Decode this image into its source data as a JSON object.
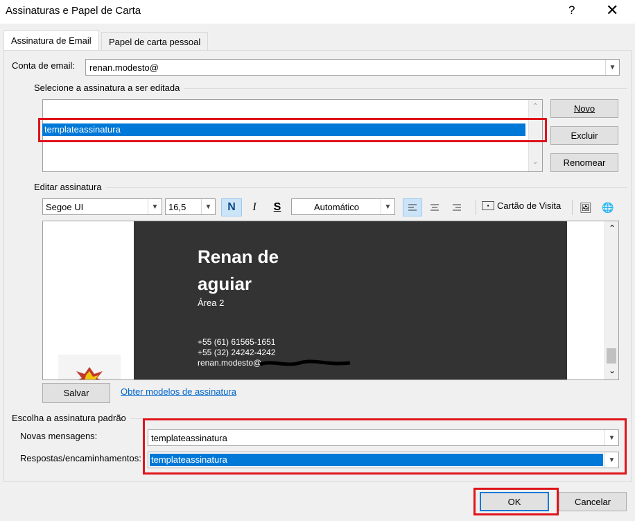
{
  "window": {
    "title": "Assinaturas e Papel de Carta",
    "help_label": "?",
    "close_label": "✕"
  },
  "tabs": [
    {
      "label": "Assinatura de Email",
      "active": true
    },
    {
      "label": "Papel de carta pessoal",
      "active": false
    }
  ],
  "account": {
    "label": "Conta de email:",
    "value": "renan.modesto@"
  },
  "select_section": {
    "label": "Selecione a assinatura a ser editada",
    "items": [
      "templateassinatura"
    ],
    "selected": "templateassinatura"
  },
  "side_buttons": {
    "new": "Novo",
    "delete": "Excluir",
    "rename": "Renomear"
  },
  "edit_section": {
    "label": "Editar assinatura",
    "font": "Segoe UI",
    "size": "16,5",
    "bold": "N",
    "italic": "I",
    "strike": "S",
    "color": "Automático",
    "business_card": "Cartão de Visita"
  },
  "signature": {
    "name_line1": "Renan de",
    "name_line2": "aguiar",
    "area": "Área 2",
    "phone1": "+55 (61) 61565-1651",
    "phone2": "+55 (32) 24242-4242",
    "email": "renan.modesto@"
  },
  "save_button": "Salvar",
  "templates_link": "Obter modelos de assinatura",
  "default_section": {
    "label": "Escolha a assinatura padrão",
    "new_messages_label": "Novas mensagens:",
    "new_messages_value": "templateassinatura",
    "replies_label": "Respostas/encaminhamentos:",
    "replies_value": "templateassinatura"
  },
  "footer": {
    "ok": "OK",
    "cancel": "Cancelar"
  },
  "colors": {
    "selection": "#0078d7",
    "highlight_box": "#e0141b",
    "signature_bg": "#333333"
  }
}
